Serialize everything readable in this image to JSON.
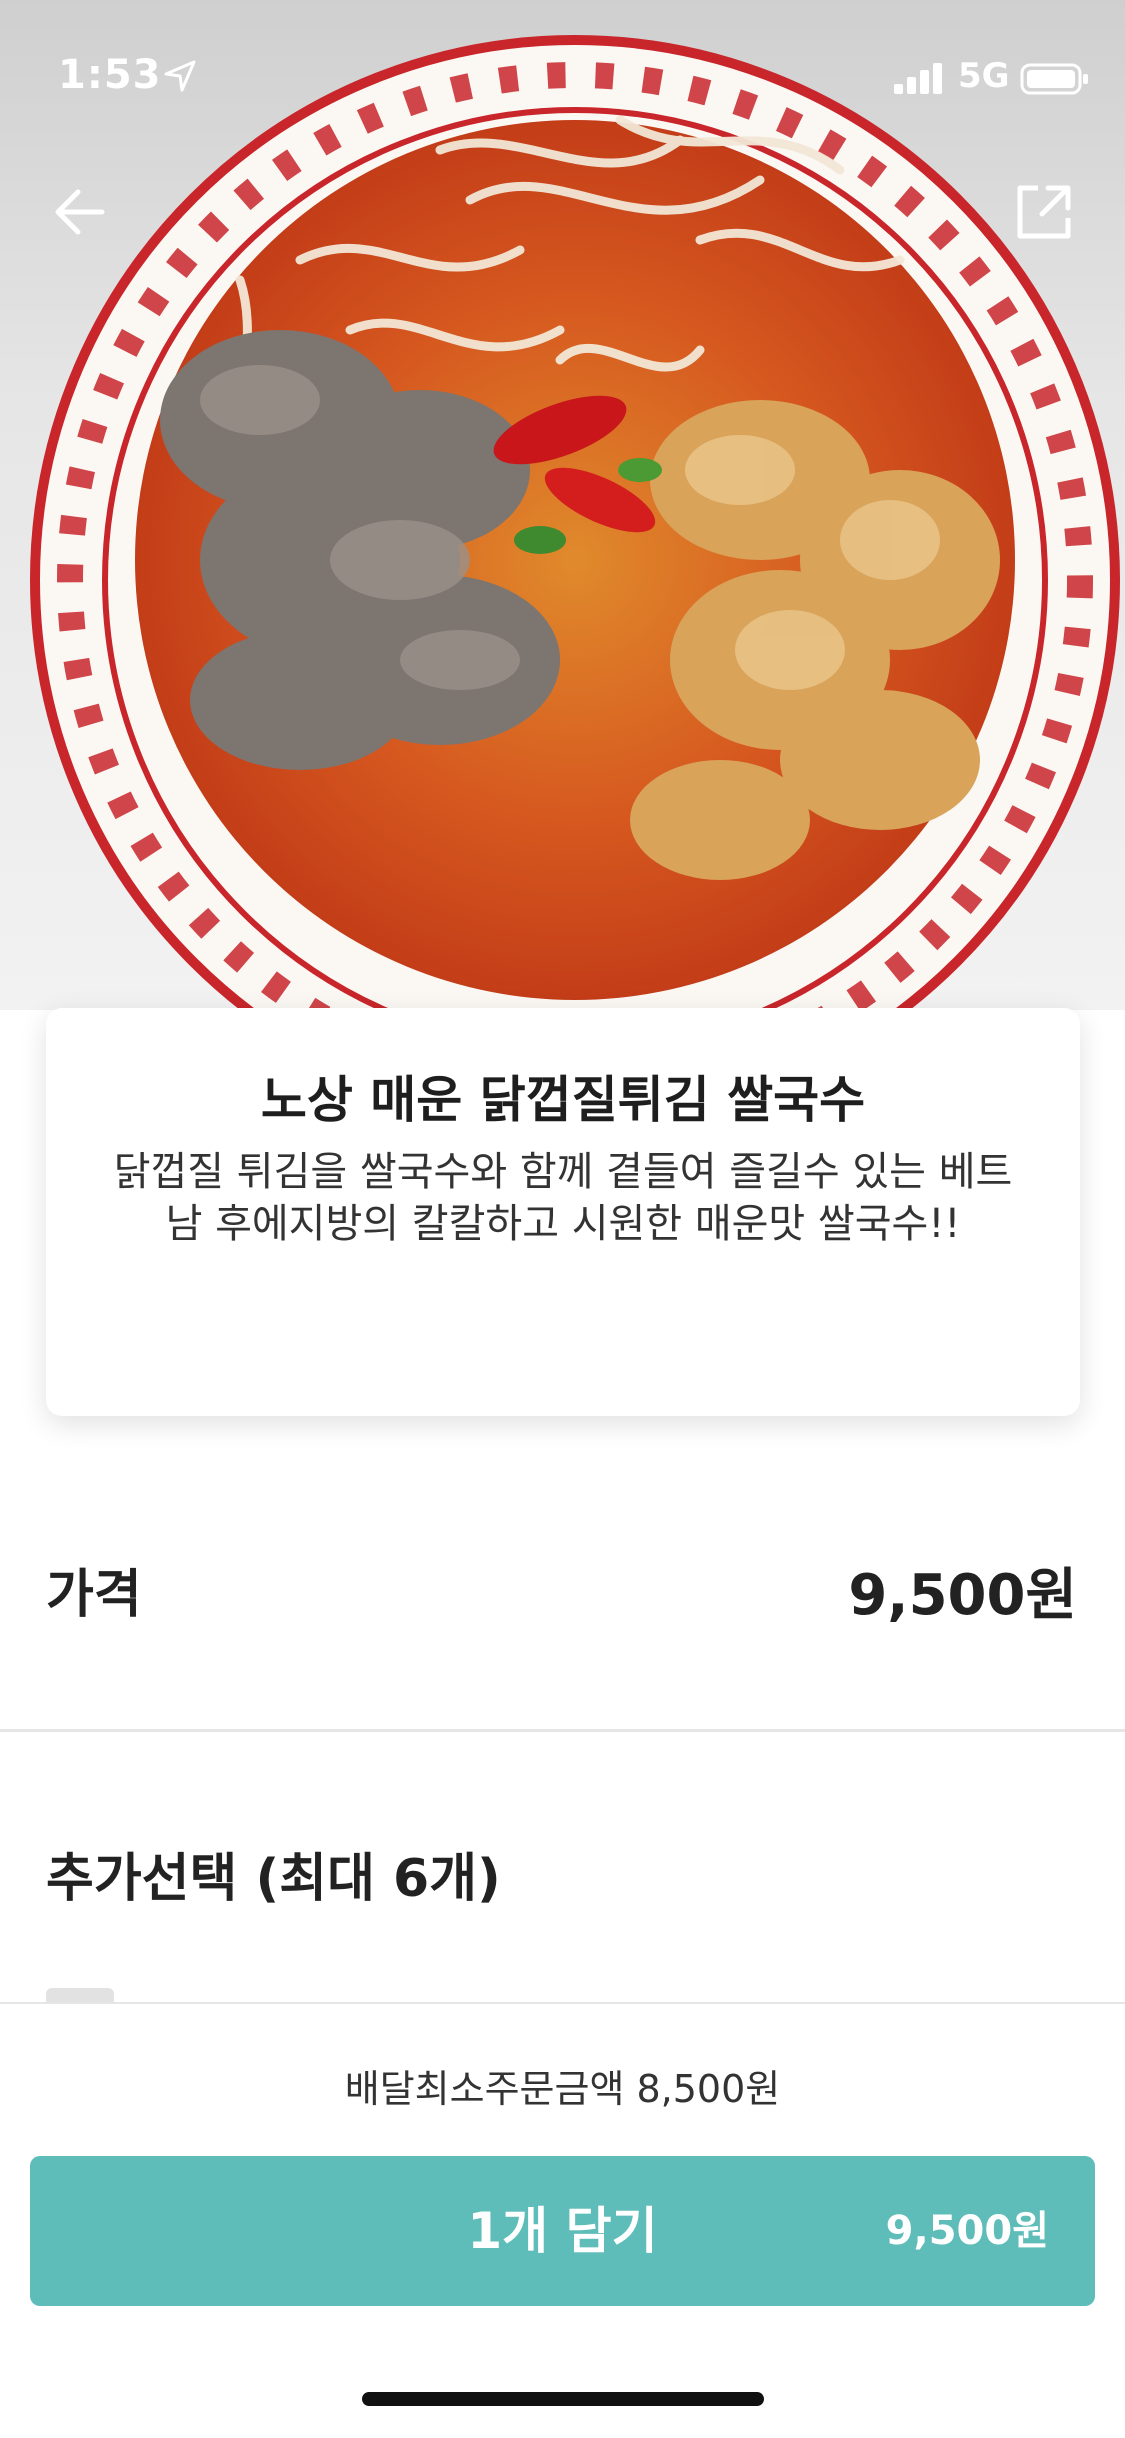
{
  "status_bar": {
    "time": "1:53",
    "network": "5G",
    "icons": [
      "location-arrow-icon",
      "signal-bars-icon",
      "battery-icon"
    ]
  },
  "nav": {
    "icons": [
      "back-arrow-icon",
      "share-icon"
    ]
  },
  "hero": {
    "image": "bowl-of-spicy-rice-noodle-soup-photo"
  },
  "menu": {
    "title": "노상 매운 닭껍질튀김 쌀국수",
    "description": "닭껍질 튀김을 쌀국수와 함께 곁들여 즐길수 있는 베트남 후에지방의 칼칼하고 시원한 매운맛 쌀국수!!"
  },
  "price": {
    "label": "가격",
    "value": "9,500원"
  },
  "options": {
    "title": "추가선택 (최대 6개)"
  },
  "footer": {
    "min_order": "배달최소주문금액 8,500원",
    "cta_label": "1개 담기",
    "cta_price": "9,500원"
  },
  "colors": {
    "accent": "#5ebcb9",
    "text": "#222222",
    "bowl_red": "#c8262a"
  }
}
